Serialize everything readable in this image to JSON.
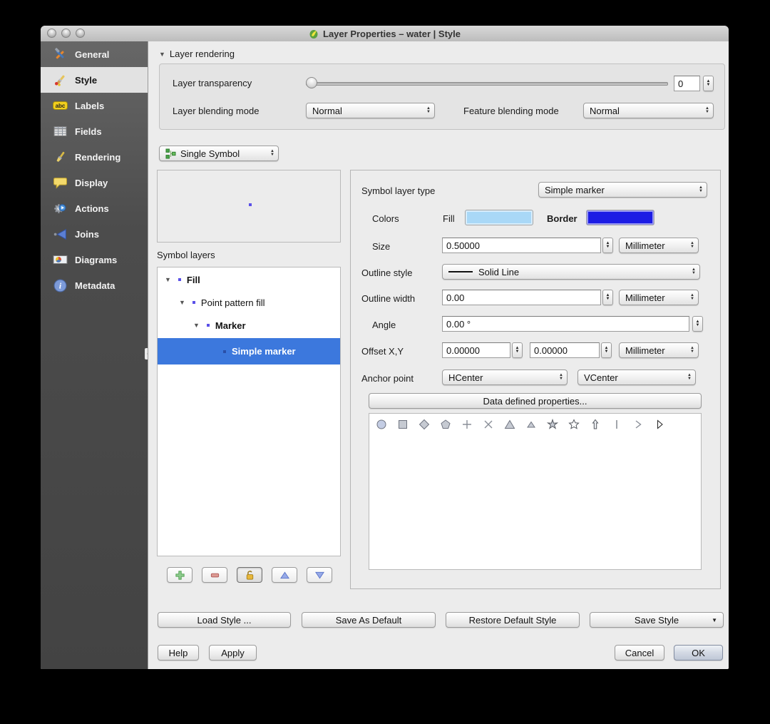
{
  "window": {
    "title": "Layer Properties – water | Style"
  },
  "sidebar": {
    "items": [
      {
        "label": "General"
      },
      {
        "label": "Style"
      },
      {
        "label": "Labels"
      },
      {
        "label": "Fields"
      },
      {
        "label": "Rendering"
      },
      {
        "label": "Display"
      },
      {
        "label": "Actions"
      },
      {
        "label": "Joins"
      },
      {
        "label": "Diagrams"
      },
      {
        "label": "Metadata"
      }
    ]
  },
  "icons": {
    "labels_abc": "abc",
    "metadata_i": "i",
    "traffic_lights": [
      "close",
      "minimize",
      "zoom"
    ],
    "layer_buttons": [
      "add-symbol-layer",
      "remove-symbol-layer",
      "lock",
      "move-up",
      "move-down"
    ],
    "marker_shapes": [
      "circle",
      "square",
      "diamond",
      "pentagon",
      "plus",
      "cross",
      "triangle",
      "triangle-small",
      "star-thin",
      "star",
      "arrow-up",
      "vertical-line",
      "chevron-right",
      "arrowhead-right"
    ]
  },
  "layer_rendering": {
    "section_label": "Layer rendering",
    "transparency_label": "Layer transparency",
    "transparency_value": "0",
    "layer_blending_label": "Layer blending mode",
    "layer_blending_value": "Normal",
    "feature_blending_label": "Feature blending mode",
    "feature_blending_value": "Normal"
  },
  "renderer": {
    "selected": "Single Symbol"
  },
  "symbol_layers": {
    "section_label": "Symbol layers",
    "tree": [
      {
        "label": "Fill"
      },
      {
        "label": "Point pattern fill"
      },
      {
        "label": "Marker"
      },
      {
        "label": "Simple marker"
      }
    ],
    "selection_color": "#3c78dd"
  },
  "symbol": {
    "symbol_layer_type_label": "Symbol layer type",
    "symbol_layer_type_value": "Simple marker",
    "colors_label": "Colors",
    "fill_label": "Fill",
    "fill_color": "#a9d8f7",
    "border_label": "Border",
    "border_color": "#1c1ce4",
    "preview_dot_color": "#5a50e8",
    "size_label": "Size",
    "size_value": "0.50000",
    "size_unit": "Millimeter",
    "outline_style_label": "Outline style",
    "outline_style_value": "Solid Line",
    "outline_width_label": "Outline width",
    "outline_width_value": "0.00",
    "outline_width_unit": "Millimeter",
    "angle_label": "Angle",
    "angle_value": "0.00 °",
    "offset_label": "Offset X,Y",
    "offset_x": "0.00000",
    "offset_y": "0.00000",
    "offset_unit": "Millimeter",
    "anchor_label": "Anchor point",
    "anchor_h": "HCenter",
    "anchor_v": "VCenter",
    "data_defined_button": "Data defined properties..."
  },
  "footer": {
    "load_style": "Load Style ...",
    "save_as_default": "Save As Default",
    "restore_default": "Restore Default Style",
    "save_style": "Save Style",
    "help": "Help",
    "apply": "Apply",
    "cancel": "Cancel",
    "ok": "OK"
  }
}
